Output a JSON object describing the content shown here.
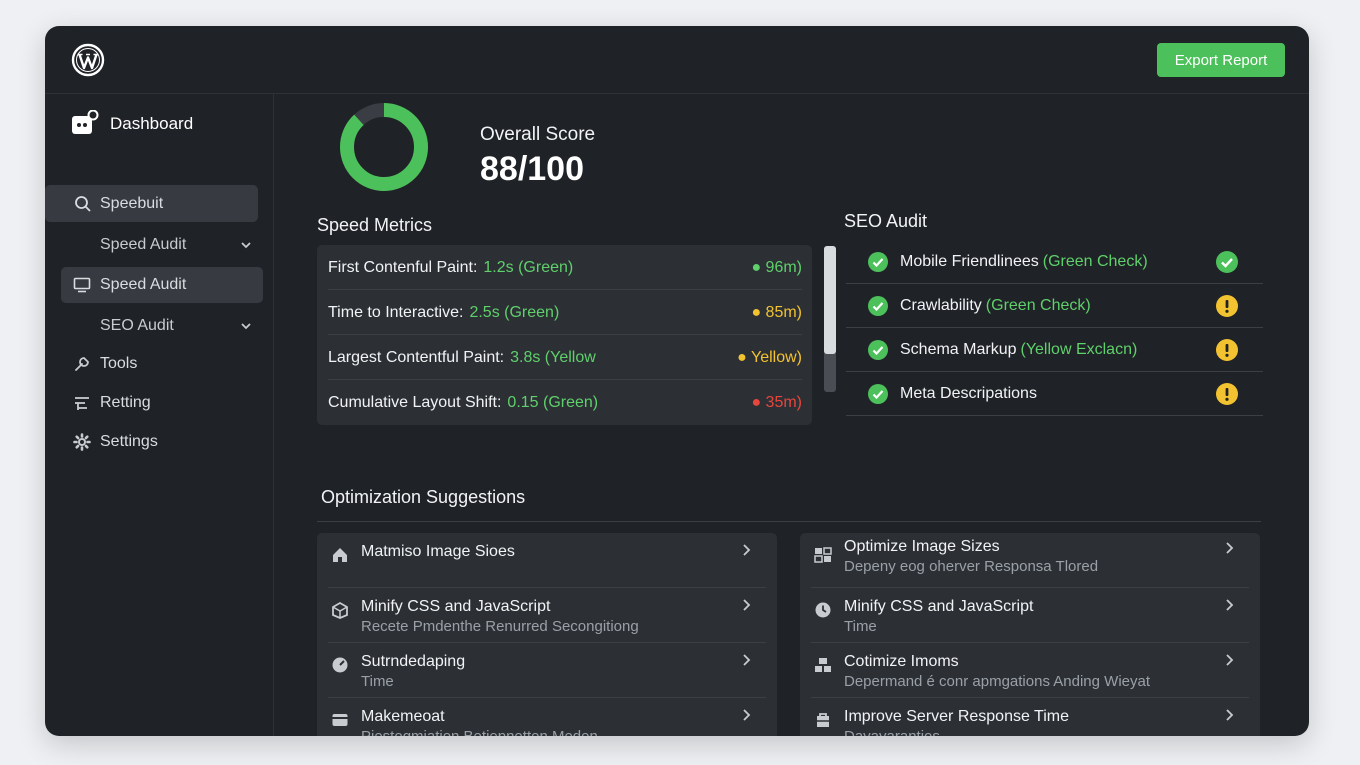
{
  "header": {
    "export_label": "Export Report"
  },
  "sidebar": {
    "title": "Dashboard",
    "items": [
      {
        "label": "Speebuit",
        "icon": "search-icon"
      },
      {
        "label": "Speed Audit",
        "icon": "chevron-down-icon"
      },
      {
        "label": "Speed Audit",
        "icon": "monitor-icon"
      },
      {
        "label": "SEO Audit",
        "icon": "chevron-down-icon"
      },
      {
        "label": "Tools",
        "icon": "tools-icon"
      },
      {
        "label": "Retting",
        "icon": "report-icon"
      },
      {
        "label": "Settings",
        "icon": "gear-icon"
      }
    ]
  },
  "score": {
    "title": "Overall Score",
    "value": "88/100",
    "fraction": 0.88
  },
  "speed_metrics": {
    "title": "Speed Metrics",
    "rows": [
      {
        "label": "First Contenful Paint:",
        "value": "1.2s (Green)",
        "status": "96m)",
        "color": "#5fd06b"
      },
      {
        "label": "Time to Interactive:",
        "value": "2.5s (Green)",
        "status": "85m)",
        "color": "#f2c230"
      },
      {
        "label": "Largest Contentful Paint:",
        "value": "3.8s (Yellow",
        "status": "Yellow)",
        "color": "#f2c230"
      },
      {
        "label": "Cumulative Layout Shift:",
        "value": "0.15 (Green)",
        "status": "35m)",
        "color": "#e8453c"
      }
    ]
  },
  "seo_audit": {
    "title": "SEO Audit",
    "rows": [
      {
        "label": "Mobile Friendlinees",
        "note": "(Green Check)",
        "status": "check"
      },
      {
        "label": "Crawlability",
        "note": "(Green Check)",
        "status": "warning"
      },
      {
        "label": "Schema Markup",
        "note": " (Yellow Exclacn)",
        "status": "warning"
      },
      {
        "label": "Meta Descripations",
        "note": "",
        "status": "warning"
      }
    ]
  },
  "optimization": {
    "title": "Optimization Suggestions",
    "left": [
      {
        "title": "Matmiso Image Sioes",
        "desc": "",
        "icon": "home-icon"
      },
      {
        "title": "Minify CSS and JavaScript",
        "desc": "Recete Pmdenthe Renurred Secongitiong",
        "icon": "box-icon"
      },
      {
        "title": "Sutrndedaping",
        "desc": "Time",
        "icon": "gauge-icon"
      },
      {
        "title": "Makemeoat",
        "desc": "Piestogmiation Betiepnetten Meden",
        "icon": "card-icon"
      }
    ],
    "right": [
      {
        "title": "Optimize Image Sizes",
        "desc": "Depeny eog oherver Responsa Tlored",
        "icon": "image-icon"
      },
      {
        "title": "Minify CSS and JavaScript",
        "desc": "Time",
        "icon": "clock-icon"
      },
      {
        "title": "Cotimize Imoms",
        "desc": "Depermand é conr apmgations Anding Wieyat",
        "icon": "cubes-icon"
      },
      {
        "title": "Improve Server Response Time",
        "desc": "Dayayarantios",
        "icon": "server-icon"
      }
    ]
  }
}
